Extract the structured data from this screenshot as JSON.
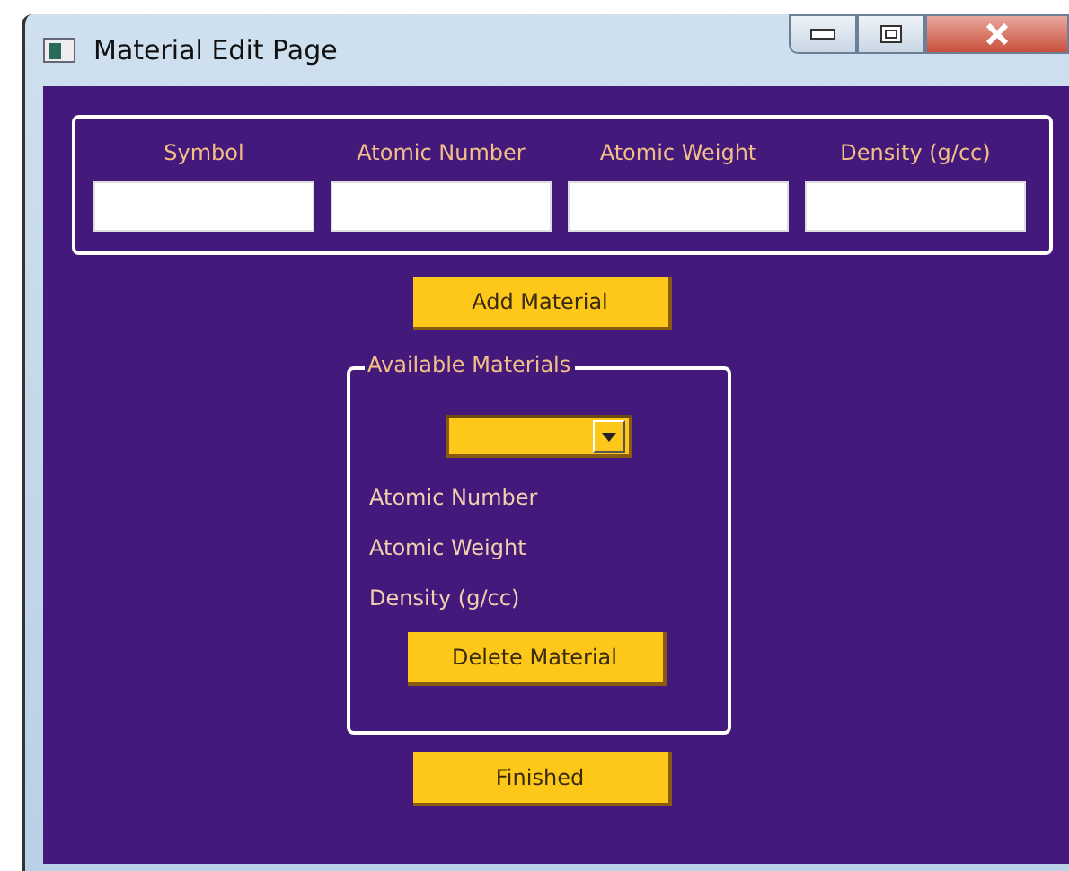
{
  "window": {
    "title": "Material Edit Page"
  },
  "new_material": {
    "fields": [
      {
        "label": "Symbol"
      },
      {
        "label": "Atomic Number"
      },
      {
        "label": "Atomic Weight"
      },
      {
        "label": "Density (g/cc)"
      }
    ]
  },
  "add_button": "Add Material",
  "available_materials": {
    "title": "Available Materials",
    "details": [
      "Atomic Number",
      "Atomic Weight",
      "Density (g/cc)"
    ],
    "delete_button": "Delete Material"
  },
  "finished_button": "Finished"
}
